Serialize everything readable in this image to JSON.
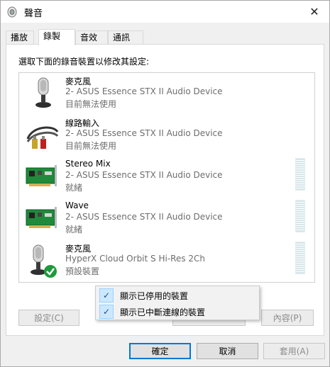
{
  "window": {
    "title": "聲音",
    "close_glyph": "✕"
  },
  "tabs": [
    {
      "label": "播放",
      "active": false
    },
    {
      "label": "錄製",
      "active": true
    },
    {
      "label": "音效",
      "active": false
    },
    {
      "label": "通訊",
      "active": false
    }
  ],
  "panel": {
    "instruction": "選取下面的錄音裝置以修改其設定:",
    "devices": [
      {
        "name": "麥克風",
        "description": "2- ASUS Essence STX II Audio Device",
        "status": "目前無法使用",
        "icon": "microphone-icon",
        "meter": false
      },
      {
        "name": "線路輸入",
        "description": "2- ASUS Essence STX II Audio Device",
        "status": "目前無法使用",
        "icon": "line-in-cable-icon",
        "meter": false
      },
      {
        "name": "Stereo Mix",
        "description": "2- ASUS Essence STX II Audio Device",
        "status": "就緒",
        "icon": "sound-card-icon",
        "meter": true
      },
      {
        "name": "Wave",
        "description": "2- ASUS Essence STX II Audio Device",
        "status": "就緒",
        "icon": "sound-card-icon",
        "meter": true
      },
      {
        "name": "麥克風",
        "description": "HyperX Cloud Orbit S Hi-Res 2Ch",
        "status": "預設裝置",
        "icon": "microphone-default-icon",
        "meter": true
      }
    ],
    "buttons": {
      "configure": "設定(C)",
      "properties": "內容(P)"
    }
  },
  "context_menu": {
    "items": [
      {
        "label": "顯示已停用的裝置",
        "checked": true
      },
      {
        "label": "顯示已中斷連線的裝置",
        "checked": true
      }
    ],
    "check_glyph": "✓"
  },
  "footer": {
    "ok": "確定",
    "cancel": "取消",
    "apply": "套用(A)"
  },
  "colors": {
    "accent": "#0078d7",
    "check_bg": "#cce8ff",
    "meter": "#d7e6ea"
  }
}
